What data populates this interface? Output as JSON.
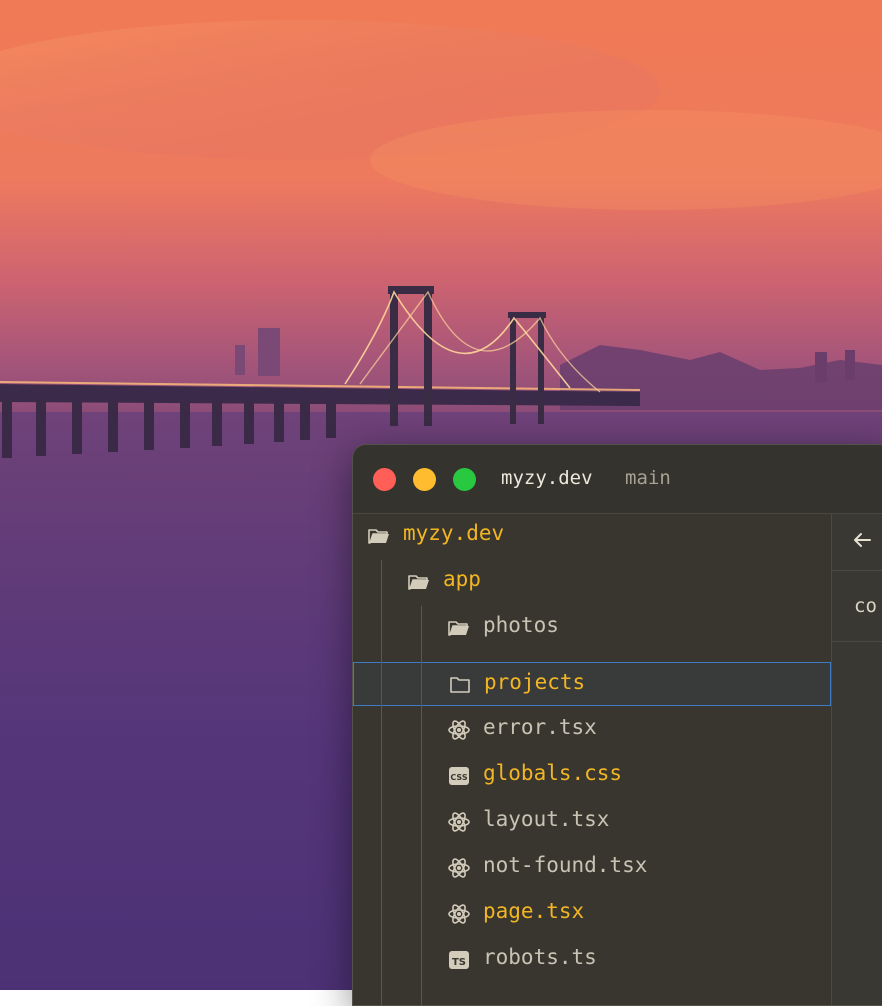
{
  "window": {
    "title": "myzy.dev",
    "branch": "main"
  },
  "editor": {
    "tab_text": "co"
  },
  "tree": [
    {
      "label": "myzy.dev",
      "icon": "folder-open-icon",
      "depth": 0,
      "color": "yellow",
      "selected": false
    },
    {
      "label": "app",
      "icon": "folder-open-icon",
      "depth": 1,
      "color": "yellow",
      "selected": false
    },
    {
      "label": "photos",
      "icon": "folder-open-icon",
      "depth": 2,
      "color": "gray",
      "selected": false
    },
    {
      "label": "projects",
      "icon": "folder-closed-icon",
      "depth": 2,
      "color": "yellow",
      "selected": true
    },
    {
      "label": "error.tsx",
      "icon": "react-icon",
      "depth": 2,
      "color": "gray",
      "selected": false
    },
    {
      "label": "globals.css",
      "icon": "css-file-icon",
      "depth": 2,
      "color": "yellow",
      "selected": false
    },
    {
      "label": "layout.tsx",
      "icon": "react-icon",
      "depth": 2,
      "color": "gray",
      "selected": false
    },
    {
      "label": "not-found.tsx",
      "icon": "react-icon",
      "depth": 2,
      "color": "gray",
      "selected": false
    },
    {
      "label": "page.tsx",
      "icon": "react-icon",
      "depth": 2,
      "color": "yellow",
      "selected": false
    },
    {
      "label": "robots.ts",
      "icon": "ts-file-icon",
      "depth": 2,
      "color": "gray",
      "selected": false
    }
  ],
  "colors": {
    "highlight_text": "#f3b623",
    "normal_text": "#c9c3b4",
    "selection_border": "#3f79c2",
    "panel_bg": "#38362f"
  }
}
